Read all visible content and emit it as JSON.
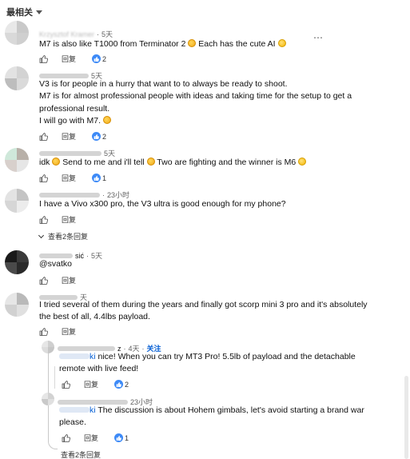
{
  "sort": {
    "label": "最相关"
  },
  "comments": [
    {
      "author": "Krzysztof Kramer",
      "time": "5天",
      "lines": [
        "M7 is also like T1000 from Terminator 2 ",
        " Each has the cute AI "
      ],
      "like_count": "2",
      "reply_label": "回复"
    },
    {
      "author": "",
      "time": "5天",
      "lines": [
        "V3 is for people in a hurry that want to to always be ready to shoot.",
        "M7 is for almost professional people with ideas and taking time for the setup to get a",
        "professional result.",
        "I will go with M7. "
      ],
      "like_count": "2",
      "reply_label": "回复"
    },
    {
      "author": "",
      "time": "5天",
      "lines": [
        "idk ",
        " Send to me and i'll tell ",
        " Two are fighting and the winner is M6 "
      ],
      "like_count": "1",
      "reply_label": "回复"
    },
    {
      "author": "",
      "time": "23小时",
      "lines": [
        "I have a Vivo x300 pro, the V3 ultra is good enough for my phone?"
      ],
      "reply_label": "回复",
      "view_replies": "查看2条回复"
    },
    {
      "author": "sić",
      "time": "5天",
      "lines": [
        "@svatko"
      ],
      "reply_label": "回复"
    },
    {
      "author": "",
      "time": "天",
      "lines": [
        "I tried several of them during the years and finally got scorp mini 3 pro and it's absolutely",
        "the best of all, 4.4lbs payload."
      ],
      "reply_label": "回复"
    }
  ],
  "replies": [
    {
      "author": "z",
      "time": "4天",
      "follow": "关注",
      "mention": "ki",
      "lines": [
        " nice! When you can try MT3 Pro! 5.5lb of payload and the detachable",
        "remote with live feed!"
      ],
      "like_count": "2",
      "reply_label": "回复"
    },
    {
      "author": "",
      "time": "23小时",
      "mention": "ki",
      "lines": [
        " The discussion is about Hohem gimbals, let's avoid starting a brand war",
        "please."
      ],
      "like_count": "1",
      "reply_label": "回复"
    }
  ],
  "bottom_view_replies": "查看2条回复",
  "colors": {
    "accent": "#065fd4",
    "badge": "#3d8af7"
  },
  "icons": [
    "thumb-up-icon",
    "thumb-down-icon",
    "more-icon",
    "chevron-down-icon",
    "laughing-emoji-icon",
    "smile-emoji-icon",
    "grimace-emoji-icon"
  ]
}
